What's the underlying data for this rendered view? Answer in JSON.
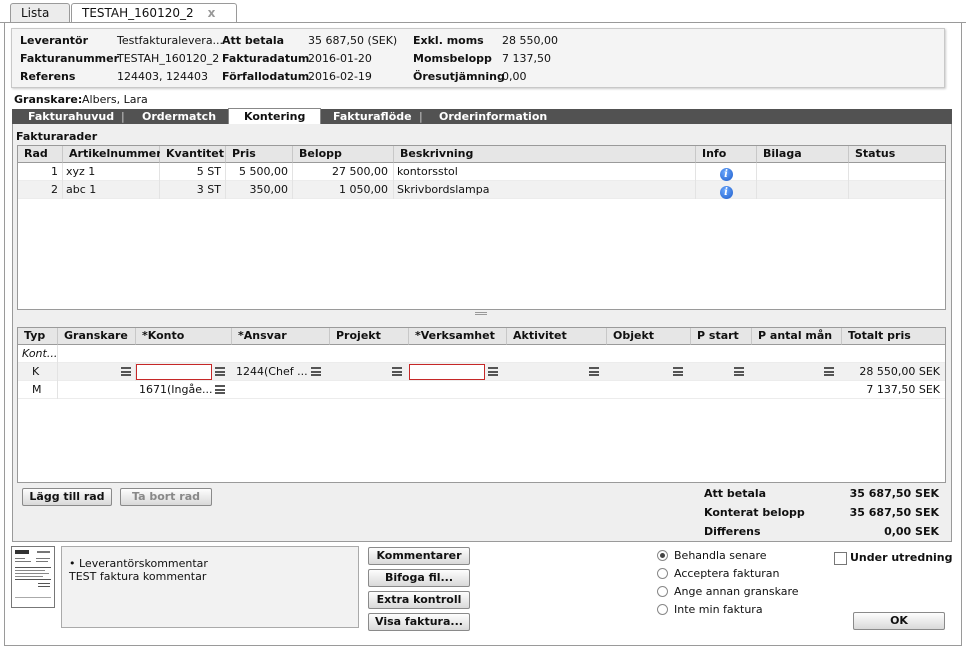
{
  "tabs": {
    "lista": "Lista",
    "current": "TESTAH_160120_2",
    "close": "x"
  },
  "header": {
    "leverantor_label": "Leverantör",
    "leverantor_value": "Testfakturalevera...",
    "fakturanummer_label": "Fakturanummer",
    "fakturanummer_value": "TESTAH_160120_2",
    "referens_label": "Referens",
    "referens_value": "124403, 124403",
    "att_betala_label": "Att betala",
    "att_betala_value": "35 687,50 (SEK)",
    "fakturadatum_label": "Fakturadatum",
    "fakturadatum_value": "2016-01-20",
    "forfallodatum_label": "Förfallodatum",
    "forfallodatum_value": "2016-02-19",
    "exkl_moms_label": "Exkl. moms",
    "exkl_moms_value": "28 550,00",
    "momsbelopp_label": "Momsbelopp",
    "momsbelopp_value": "7 137,50",
    "oresutjamning_label": "Öresutjämning",
    "oresutjamning_value": "0,00"
  },
  "granskare": {
    "label": "Granskare:",
    "value": "Albers, Lara"
  },
  "nav": [
    "Fakturahuvud",
    "Ordermatch",
    "Kontering",
    "Fakturaflöde",
    "Orderinformation"
  ],
  "fakturarader": {
    "title": "Fakturarader",
    "columns": [
      "Rad",
      "Artikelnummer",
      "Kvantitet",
      "Pris",
      "Belopp",
      "Beskrivning",
      "Info",
      "Bilaga",
      "Status"
    ],
    "rows": [
      {
        "rad": "1",
        "art": "xyz 1",
        "kvantitet": "5 ST",
        "pris": "5 500,00",
        "belopp": "27 500,00",
        "beskrivning": "kontorsstol"
      },
      {
        "rad": "2",
        "art": "abc 1",
        "kvantitet": "3 ST",
        "pris": "350,00",
        "belopp": "1 050,00",
        "beskrivning": "Skrivbordslampa"
      }
    ]
  },
  "kontering": {
    "columns": [
      "Typ",
      "Granskare",
      "*Konto",
      "*Ansvar",
      "Projekt",
      "*Verksamhet",
      "Aktivitet",
      "Objekt",
      "P start",
      "P antal mån",
      "Totalt pris"
    ],
    "rows": [
      {
        "typ": "Kont..."
      },
      {
        "typ": "K",
        "ansvar": "1244(Chef ...",
        "totalt": "28 550,00 SEK"
      },
      {
        "typ": "M",
        "konto": "1671(Ingåe...",
        "totalt": "7 137,50 SEK"
      }
    ]
  },
  "buttons": {
    "lagg_till_rad": "Lägg till rad",
    "ta_bort_rad": "Ta bort rad",
    "kommentarer": "Kommentarer",
    "bifoga_fil": "Bifoga fil...",
    "extra_kontroll": "Extra kontroll",
    "visa_faktura": "Visa faktura...",
    "ok": "OK"
  },
  "summary": {
    "att_betala_label": "Att betala",
    "att_betala_value": "35 687,50 SEK",
    "konterat_label": "Konterat belopp",
    "konterat_value": "35 687,50 SEK",
    "differens_label": "Differens",
    "differens_value": "0,00 SEK"
  },
  "comments": {
    "bullet": "• Leverantörskommentar",
    "text": "TEST faktura kommentar"
  },
  "options": {
    "behandla_senare": "Behandla senare",
    "acceptera": "Acceptera fakturan",
    "ange_annan": "Ange annan granskare",
    "inte_min": "Inte min faktura",
    "selected": "behandla_senare"
  },
  "under_utredning": "Under utredning"
}
